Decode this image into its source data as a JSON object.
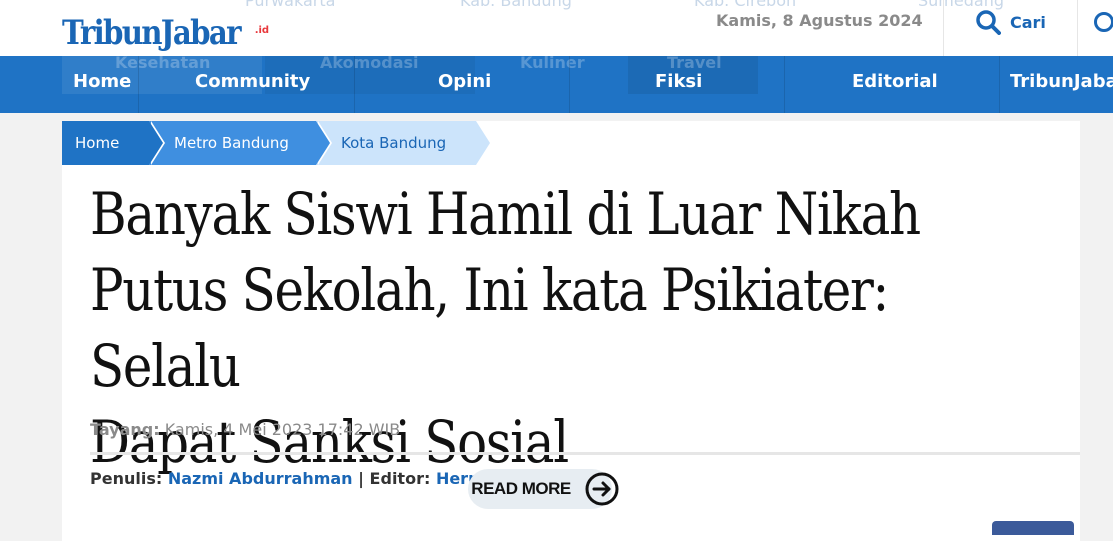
{
  "header": {
    "logo_text": "TribunJabar",
    "logo_suffix": ".id",
    "date": "Kamis, 8 Agustus 2024",
    "search_label": "Cari",
    "faded_menu_top": [
      "Purwakarta",
      "Kab. Bandung",
      "Kab. Cirebon",
      "Sumedang"
    ],
    "faded_menu_nav": [
      "Kesehatan",
      "Akomodasi",
      "Kuliner",
      "Travel"
    ]
  },
  "nav": {
    "items": [
      "Home",
      "Community",
      "Opini",
      "Fiksi",
      "Editorial",
      "TribunJabar"
    ]
  },
  "breadcrumb": [
    "Home",
    "Metro Bandung",
    "Kota Bandung"
  ],
  "article": {
    "title_line1": "Banyak Siswi Hamil di Luar Nikah",
    "title_line2": "Putus Sekolah, Ini kata Psikiater: Selalu",
    "title_line3": "Dapat Sanksi Sosial",
    "published_label": "Tayang:",
    "published_value": "Kamis, 4 Mei 2023 17:42 WIB",
    "writer_label": "Penulis:",
    "writer_name": "Nazmi Abdurrahman",
    "editor_label": "| Editor:",
    "editor_name": "Hermawan"
  },
  "read_more": {
    "label": "READ MORE",
    "icon": "arrow-right-circle-icon"
  },
  "colors": {
    "brand_blue": "#1f73c5",
    "link_blue": "#1a66b5",
    "breadcrumb_light": "#cce4fb"
  }
}
